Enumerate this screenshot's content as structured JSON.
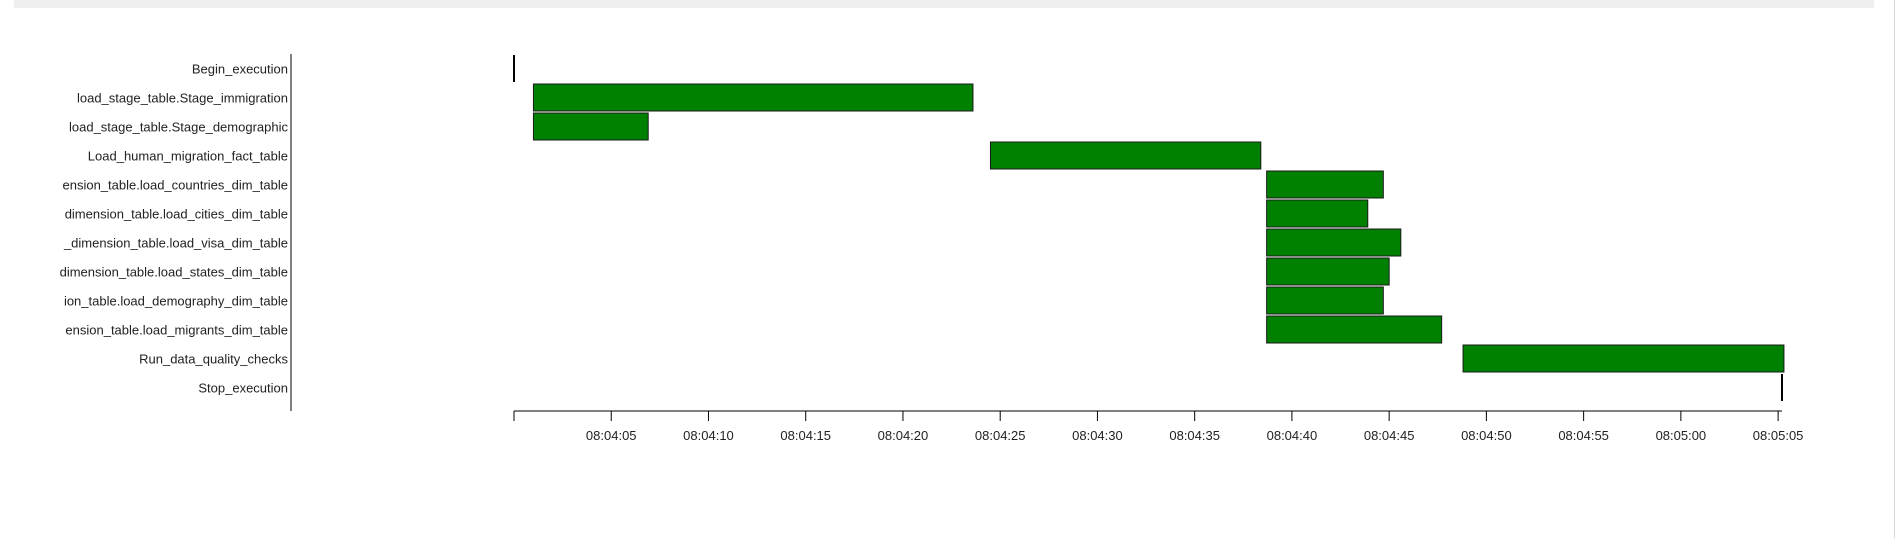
{
  "chart_data": {
    "type": "gantt",
    "colors": {
      "bar_fill": "#008000",
      "bar_stroke": "#1a1a1a",
      "marker": "#000000"
    },
    "tasks": [
      {
        "label": "Begin_execution",
        "start": "08:04:00",
        "end": "08:04:00"
      },
      {
        "label": "load_stage_table.Stage_immigration",
        "start": "08:04:01",
        "end": "08:04:23.6"
      },
      {
        "label": "load_stage_table.Stage_demographic",
        "start": "08:04:01",
        "end": "08:04:06.9"
      },
      {
        "label": "Load_human_migration_fact_table",
        "start": "08:04:24.5",
        "end": "08:04:38.4"
      },
      {
        "label": "ension_table.load_countries_dim_table",
        "start": "08:04:38.7",
        "end": "08:04:44.7"
      },
      {
        "label": "dimension_table.load_cities_dim_table",
        "start": "08:04:38.7",
        "end": "08:04:43.9"
      },
      {
        "label": "_dimension_table.load_visa_dim_table",
        "start": "08:04:38.7",
        "end": "08:04:45.6"
      },
      {
        "label": "dimension_table.load_states_dim_table",
        "start": "08:04:38.7",
        "end": "08:04:45.0"
      },
      {
        "label": "ion_table.load_demography_dim_table",
        "start": "08:04:38.7",
        "end": "08:04:44.7"
      },
      {
        "label": "ension_table.load_migrants_dim_table",
        "start": "08:04:38.7",
        "end": "08:04:47.7"
      },
      {
        "label": "Run_data_quality_checks",
        "start": "08:04:48.8",
        "end": "08:05:05.3"
      },
      {
        "label": "Stop_execution",
        "start": "08:05:05.2",
        "end": "08:05:05.2"
      }
    ],
    "x_ticks": [
      "08:04:05",
      "08:04:10",
      "08:04:15",
      "08:04:20",
      "08:04:25",
      "08:04:30",
      "08:04:35",
      "08:04:40",
      "08:04:45",
      "08:04:50",
      "08:04:55",
      "08:05:00",
      "08:05:05"
    ],
    "xlim": [
      "08:04:00",
      "08:05:05.2"
    ],
    "grid": false
  }
}
